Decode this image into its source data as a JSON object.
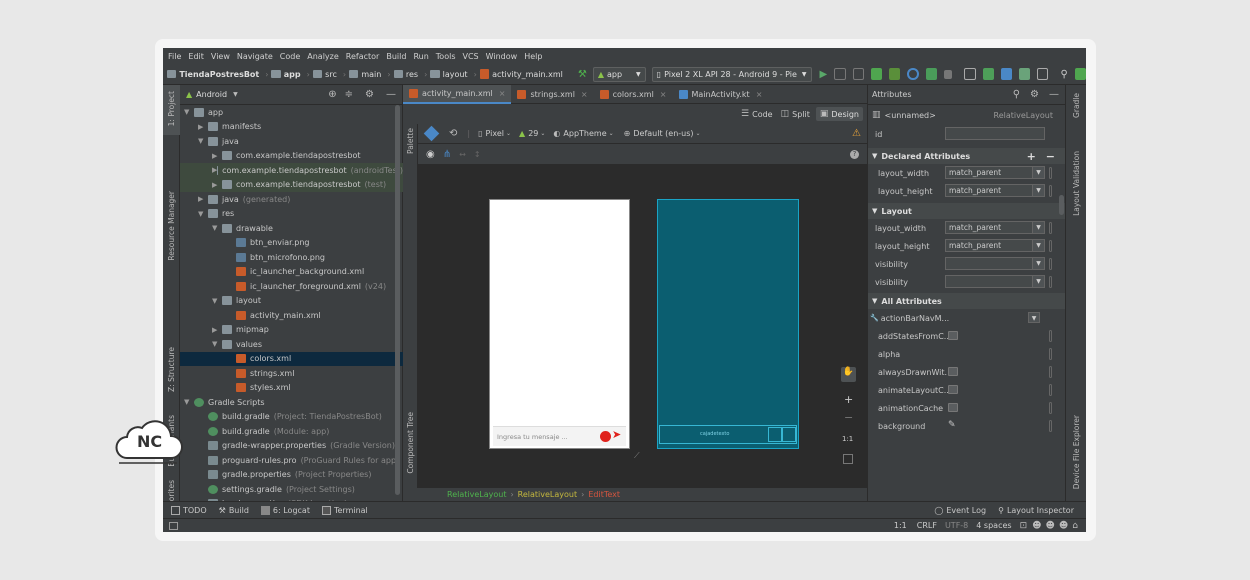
{
  "menu": [
    "File",
    "Edit",
    "View",
    "Navigate",
    "Code",
    "Analyze",
    "Refactor",
    "Build",
    "Run",
    "Tools",
    "VCS",
    "Window",
    "Help"
  ],
  "navbar": {
    "crumbs": [
      "TiendaPostresBot",
      "app",
      "src",
      "main",
      "res",
      "layout",
      "activity_main.xml"
    ],
    "run_config": "app",
    "device": "Pixel 2 XL API 28 - Android 9 - Pie"
  },
  "left_strip": {
    "project": "1: Project",
    "resource_manager": "Resource Manager",
    "structure": "Z: Structure",
    "build_variants": "Build Variants",
    "favorites": "2: Favorites"
  },
  "project": {
    "view": "Android",
    "tree": [
      {
        "label": "app",
        "sub": "",
        "indent": 0,
        "type": "module",
        "tri": "▼"
      },
      {
        "label": "manifests",
        "sub": "",
        "indent": 1,
        "type": "folder",
        "tri": "▶"
      },
      {
        "label": "java",
        "sub": "",
        "indent": 1,
        "type": "folder",
        "tri": "▼"
      },
      {
        "label": "com.example.tiendapostresbot",
        "sub": "",
        "indent": 2,
        "type": "package",
        "tri": "▶"
      },
      {
        "label": "com.example.tiendapostresbot",
        "sub": "(androidTest)",
        "indent": 2,
        "type": "package",
        "tri": "▶"
      },
      {
        "label": "com.example.tiendapostresbot",
        "sub": "(test)",
        "indent": 2,
        "type": "package",
        "tri": "▶"
      },
      {
        "label": "java",
        "sub": "(generated)",
        "indent": 1,
        "type": "folder",
        "tri": "▶"
      },
      {
        "label": "res",
        "sub": "",
        "indent": 1,
        "type": "folder",
        "tri": "▼"
      },
      {
        "label": "drawable",
        "sub": "",
        "indent": 2,
        "type": "folder",
        "tri": "▼"
      },
      {
        "label": "btn_enviar.png",
        "sub": "",
        "indent": 3,
        "type": "image",
        "tri": ""
      },
      {
        "label": "btn_microfono.png",
        "sub": "",
        "indent": 3,
        "type": "image",
        "tri": ""
      },
      {
        "label": "ic_launcher_background.xml",
        "sub": "",
        "indent": 3,
        "type": "xml",
        "tri": ""
      },
      {
        "label": "ic_launcher_foreground.xml",
        "sub": "(v24)",
        "indent": 3,
        "type": "xml",
        "tri": ""
      },
      {
        "label": "layout",
        "sub": "",
        "indent": 2,
        "type": "folder",
        "tri": "▼"
      },
      {
        "label": "activity_main.xml",
        "sub": "",
        "indent": 3,
        "type": "xml",
        "tri": ""
      },
      {
        "label": "mipmap",
        "sub": "",
        "indent": 2,
        "type": "folder",
        "tri": "▶"
      },
      {
        "label": "values",
        "sub": "",
        "indent": 2,
        "type": "folder",
        "tri": "▼"
      },
      {
        "label": "colors.xml",
        "sub": "",
        "indent": 3,
        "type": "xml",
        "tri": ""
      },
      {
        "label": "strings.xml",
        "sub": "",
        "indent": 3,
        "type": "xml",
        "tri": ""
      },
      {
        "label": "styles.xml",
        "sub": "",
        "indent": 3,
        "type": "xml",
        "tri": ""
      },
      {
        "label": "Gradle Scripts",
        "sub": "",
        "indent": 0,
        "type": "gradle",
        "tri": "▼"
      },
      {
        "label": "build.gradle",
        "sub": "(Project: TiendaPostresBot)",
        "indent": 1,
        "type": "gradle",
        "tri": ""
      },
      {
        "label": "build.gradle",
        "sub": "(Module: app)",
        "indent": 1,
        "type": "gradle",
        "tri": ""
      },
      {
        "label": "gradle-wrapper.properties",
        "sub": "(Gradle Version)",
        "indent": 1,
        "type": "props",
        "tri": ""
      },
      {
        "label": "proguard-rules.pro",
        "sub": "(ProGuard Rules for app)",
        "indent": 1,
        "type": "props",
        "tri": ""
      },
      {
        "label": "gradle.properties",
        "sub": "(Project Properties)",
        "indent": 1,
        "type": "props",
        "tri": ""
      },
      {
        "label": "settings.gradle",
        "sub": "(Project Settings)",
        "indent": 1,
        "type": "gradle",
        "tri": ""
      },
      {
        "label": "local.properties",
        "sub": "(SDK Location)",
        "indent": 1,
        "type": "props",
        "tri": ""
      }
    ]
  },
  "tabs": [
    {
      "label": "activity_main.xml",
      "active": true
    },
    {
      "label": "strings.xml",
      "active": false
    },
    {
      "label": "colors.xml",
      "active": false
    },
    {
      "label": "MainActivity.kt",
      "active": false
    }
  ],
  "design_modes": {
    "code": "Code",
    "split": "Split",
    "design": "Design"
  },
  "design_toolbar": {
    "device": "Pixel",
    "api": "29",
    "theme": "AppTheme",
    "locale": "Default (en-us)"
  },
  "palette_label": "Palette",
  "component_tree_label": "Component Tree",
  "preview": {
    "placeholder": "Ingresa tu mensaje ...",
    "blueprint_text": "cajadetexto"
  },
  "zoom": {
    "ratio": "1:1"
  },
  "breadcrumb": [
    "RelativeLayout",
    "RelativeLayout",
    "EditText"
  ],
  "attributes": {
    "title": "Attributes",
    "component": "<unnamed>",
    "component_type": "RelativeLayout",
    "id_label": "id",
    "sections": {
      "declared": "Declared Attributes",
      "layout": "Layout",
      "all": "All Attributes"
    },
    "declared": [
      {
        "name": "layout_width",
        "value": "match_parent"
      },
      {
        "name": "layout_height",
        "value": "match_parent"
      }
    ],
    "layout": [
      {
        "name": "layout_width",
        "value": "match_parent"
      },
      {
        "name": "layout_height",
        "value": "match_parent"
      },
      {
        "name": "visibility",
        "value": ""
      },
      {
        "name": "visibility",
        "value": ""
      }
    ],
    "all": [
      "actionBarNavM...",
      "addStatesFromC...",
      "alpha",
      "alwaysDrawnWit...",
      "animateLayoutC...",
      "animationCache",
      "background"
    ]
  },
  "right_strip": {
    "gradle": "Gradle",
    "layout_validation": "Layout Validation",
    "device_file_explorer": "Device File Explorer"
  },
  "tool_windows": {
    "todo": "TODO",
    "build": "Build",
    "logcat": "6: Logcat",
    "terminal": "Terminal",
    "event_log": "Event Log",
    "layout_inspector": "Layout Inspector"
  },
  "status": {
    "position": "1:1",
    "line_sep": "CRLF",
    "encoding": "UTF-8",
    "indent": "4 spaces"
  },
  "watermark": {
    "text": "NC"
  },
  "colors": {
    "teal": "#0b5e70",
    "accent_blue": "#4a88c7",
    "selection": "#0d293e",
    "test_green": "#3e4a3e",
    "send_red": "#e0221c"
  }
}
